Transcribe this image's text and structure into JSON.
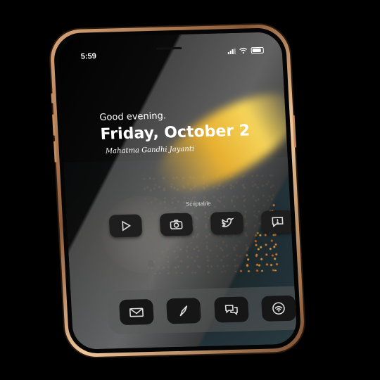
{
  "status_bar": {
    "time": "5:59"
  },
  "widget": {
    "greeting": "Good evening.",
    "date": "Friday, October 2",
    "holiday": "Mahatma Gandhi Jayanti"
  },
  "folder_label": "Scriptable",
  "apps": [
    {
      "icon": "play-icon"
    },
    {
      "icon": "camera-icon"
    },
    {
      "icon": "twitter-icon"
    },
    {
      "icon": "chat-alert-icon"
    }
  ],
  "dock": [
    {
      "icon": "mail-icon"
    },
    {
      "icon": "compass-icon"
    },
    {
      "icon": "messages-icon"
    },
    {
      "icon": "podcast-icon"
    }
  ],
  "colors": {
    "phone_frame": "#d9a67a",
    "icon_bg": "#1e1e1e",
    "icon_stroke": "#dddddd",
    "flame": "#ffbf28"
  }
}
